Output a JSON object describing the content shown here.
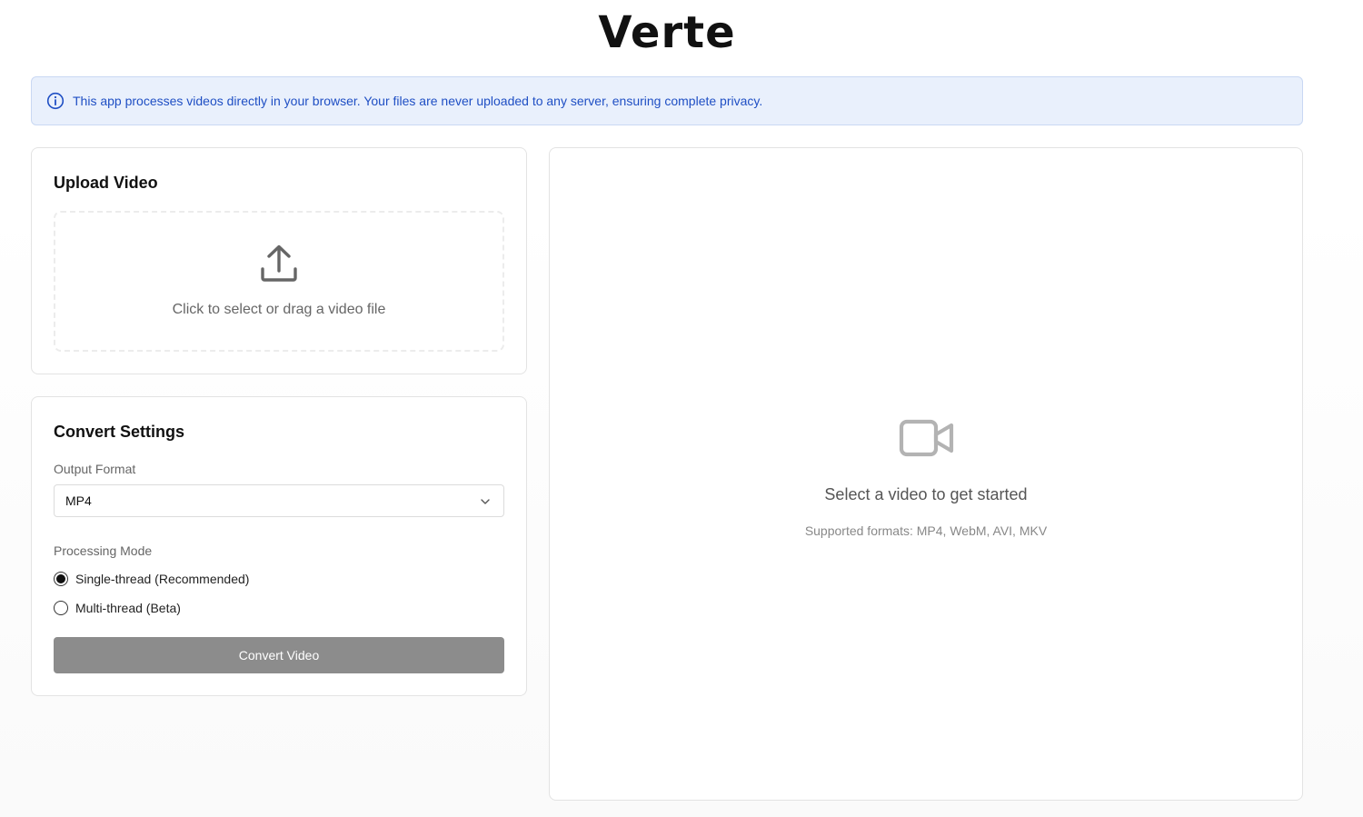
{
  "app": {
    "title": "Verte"
  },
  "notice": {
    "text": "This app processes videos directly in your browser. Your files are never uploaded to any server, ensuring complete privacy."
  },
  "upload": {
    "title": "Upload Video",
    "dropzone_text": "Click to select or drag a video file"
  },
  "settings": {
    "title": "Convert Settings",
    "output_format_label": "Output Format",
    "output_format_value": "MP4",
    "processing_mode_label": "Processing Mode",
    "modes": [
      {
        "label": "Single-thread (Recommended)",
        "checked": true
      },
      {
        "label": "Multi-thread (Beta)",
        "checked": false
      }
    ],
    "convert_button": "Convert Video"
  },
  "preview": {
    "title": "Select a video to get started",
    "supported": "Supported formats: MP4, WebM, AVI, MKV"
  },
  "colors": {
    "notice_bg": "#e9f0fc",
    "notice_text": "#1f4fc4",
    "button_disabled": "#8c8c8c"
  },
  "icons": [
    "info-icon",
    "upload-icon",
    "chevron-down-icon",
    "video-camera-icon"
  ]
}
